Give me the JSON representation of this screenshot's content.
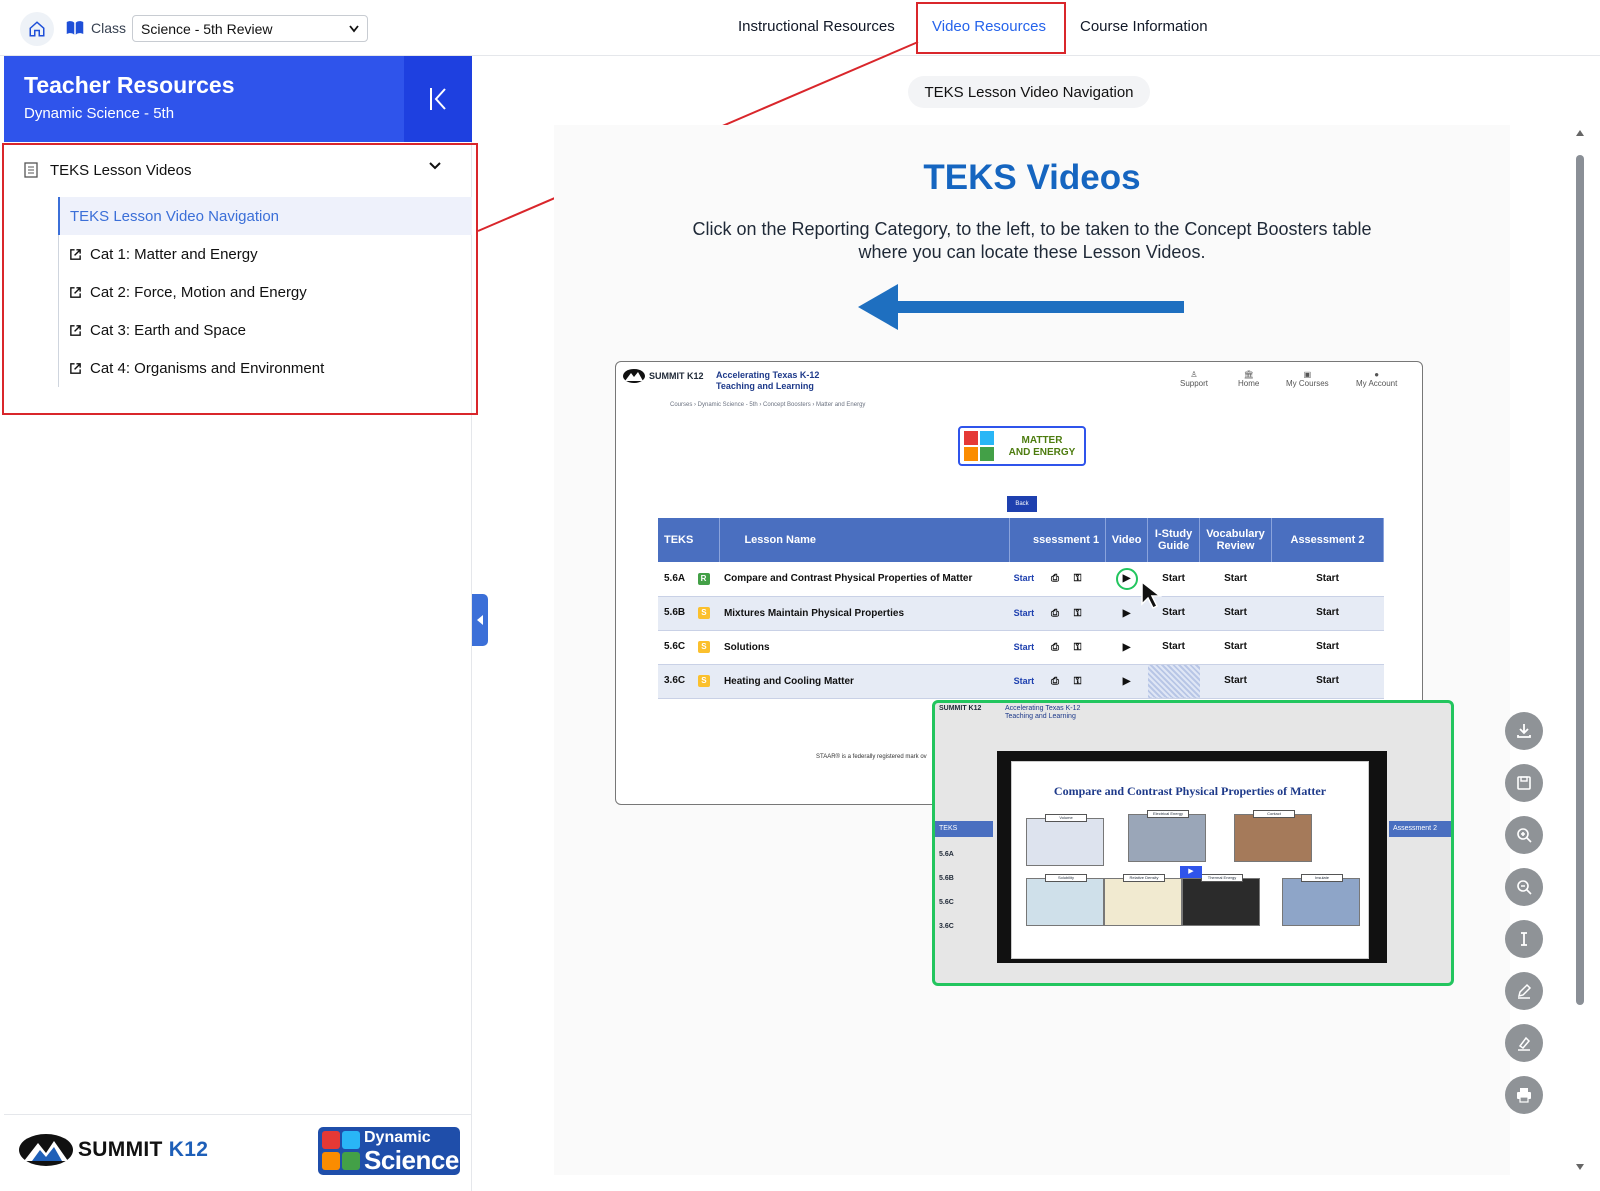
{
  "header": {
    "class_label": "Class",
    "class_value": "Science - 5th Review",
    "tabs": [
      {
        "label": "Instructional Resources"
      },
      {
        "label": "Video Resources"
      },
      {
        "label": "Course Information"
      }
    ],
    "active_tab": "Video Resources"
  },
  "sidebar": {
    "title": "Teacher Resources",
    "subtitle": "Dynamic Science - 5th",
    "section": "TEKS Lesson Videos",
    "items": [
      {
        "label": "TEKS Lesson Video Navigation"
      },
      {
        "label": "Cat 1: Matter and Energy"
      },
      {
        "label": "Cat 2: Force, Motion and Energy"
      },
      {
        "label": "Cat 3: Earth and Space"
      },
      {
        "label": "Cat 4: Organisms and Environment"
      }
    ],
    "footer": {
      "logo_summit": "SUMMIT",
      "logo_k12": "K12",
      "logo_dynamic": "Dynamic",
      "logo_science": "Science"
    }
  },
  "main": {
    "pill": "TEKS Lesson Video Navigation",
    "title": "TEKS Videos",
    "line1": "Click on the Reporting Category, to the left, to be taken to the Concept Boosters table",
    "line2": "where you can locate these Lesson Videos."
  },
  "screenshot": {
    "logo": "SUMMIT K12",
    "tagline1": "Accelerating Texas K-12",
    "tagline2": "Teaching and Learning",
    "nav": [
      "Support",
      "Home",
      "My Courses",
      "My Account"
    ],
    "crumb": "Courses › Dynamic Science - 5th › Concept Boosters › Matter and Energy",
    "badge1": "MATTER",
    "badge2": "AND ENERGY",
    "back": "Back",
    "columns": [
      "TEKS",
      "Lesson Name",
      "ssessment 1",
      "Video",
      "I-Study Guide",
      "Vocabulary Review",
      "Assessment 2"
    ],
    "start": "Start",
    "rows": [
      {
        "teks": "5.6A",
        "level": "R",
        "name": "Compare and Contrast Physical Properties of Matter"
      },
      {
        "teks": "5.6B",
        "level": "S",
        "name": "Mixtures Maintain Physical Properties"
      },
      {
        "teks": "5.6C",
        "level": "S",
        "name": "Solutions"
      },
      {
        "teks": "3.6C",
        "level": "S",
        "name": "Heating and Cooling Matter"
      }
    ],
    "footnote": "STAAR® is a federally registered mark ov",
    "slide_title": "Compare and Contrast Physical Properties of Matter",
    "tiles": [
      "Volume",
      "Electrical Energy",
      "Contact",
      "Solubility",
      "Relative Density",
      "Thermal Energy",
      "Insulate"
    ]
  },
  "colors": {
    "sidebar_header": "#2f54eb",
    "accent": "#2563eb",
    "highlight_red": "#d9262b",
    "highlight_green": "#22c55e",
    "title_blue": "#1565c0"
  },
  "tool_icons": [
    "download-icon",
    "save-icon",
    "zoom-in-icon",
    "zoom-out-icon",
    "text-cursor-icon",
    "pen-icon",
    "highlighter-icon",
    "print-icon"
  ]
}
